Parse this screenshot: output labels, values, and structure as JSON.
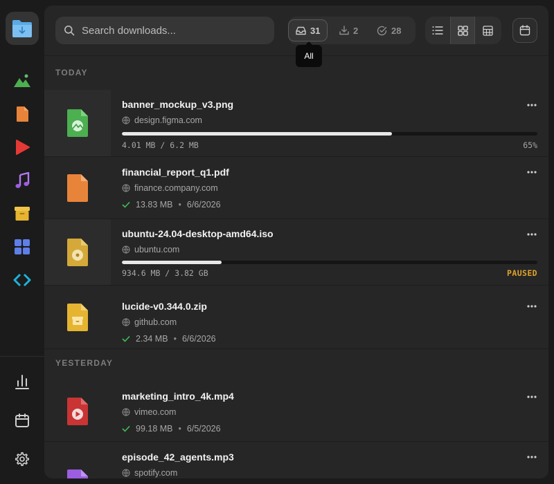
{
  "sidebar": {
    "categories": [
      {
        "icon": "image-icon",
        "color": "#4caf50"
      },
      {
        "icon": "document-icon",
        "color": "#e8843a"
      },
      {
        "icon": "video-icon",
        "color": "#e53935"
      },
      {
        "icon": "music-icon",
        "color": "#9c5de0"
      },
      {
        "icon": "archive-icon",
        "color": "#e5b431"
      },
      {
        "icon": "apps-icon",
        "color": "#5f7fe8"
      },
      {
        "icon": "code-icon",
        "color": "#1fb2d8"
      }
    ],
    "bottom": [
      "stats-icon",
      "calendar-icon",
      "settings-icon"
    ]
  },
  "search": {
    "placeholder": "Search downloads..."
  },
  "filters": [
    {
      "name": "all",
      "icon": "inbox-icon",
      "count": "31",
      "active": true
    },
    {
      "name": "downloading",
      "icon": "download-icon",
      "count": "2",
      "active": false
    },
    {
      "name": "completed",
      "icon": "check-circle-icon",
      "count": "28",
      "active": false
    }
  ],
  "tooltip": "All",
  "views": [
    "list-view",
    "grid-view",
    "table-view"
  ],
  "active_view": "grid-view",
  "sections": [
    {
      "label": "TODAY"
    },
    {
      "label": "YESTERDAY"
    }
  ],
  "downloads": [
    {
      "name": "banner_mockup_v3.png",
      "host": "design.figma.com",
      "status": "downloading",
      "progress_text": "4.01 MB / 6.2 MB",
      "progress": 0.65,
      "right": "65%",
      "type": "image",
      "color": "#4caf50"
    },
    {
      "name": "financial_report_q1.pdf",
      "host": "finance.company.com",
      "status": "completed",
      "size": "13.83 MB",
      "date": "6/6/2026",
      "type": "document",
      "color": "#e8843a"
    },
    {
      "name": "ubuntu-24.04-desktop-amd64.iso",
      "host": "ubuntu.com",
      "status": "paused",
      "progress_text": "934.6 MB / 3.82 GB",
      "progress": 0.24,
      "right": "PAUSED",
      "type": "disc",
      "color": "#d4a93a"
    },
    {
      "name": "lucide-v0.344.0.zip",
      "host": "github.com",
      "status": "completed",
      "size": "2.34 MB",
      "date": "6/6/2026",
      "type": "archive",
      "color": "#e5b431"
    },
    {
      "name": "marketing_intro_4k.mp4",
      "host": "vimeo.com",
      "status": "completed",
      "size": "99.18 MB",
      "date": "6/5/2026",
      "type": "video",
      "color": "#d63a3a"
    },
    {
      "name": "episode_42_agents.mp3",
      "host": "spotify.com",
      "status": "completed",
      "type": "audio",
      "color": "#9c5de0"
    }
  ]
}
